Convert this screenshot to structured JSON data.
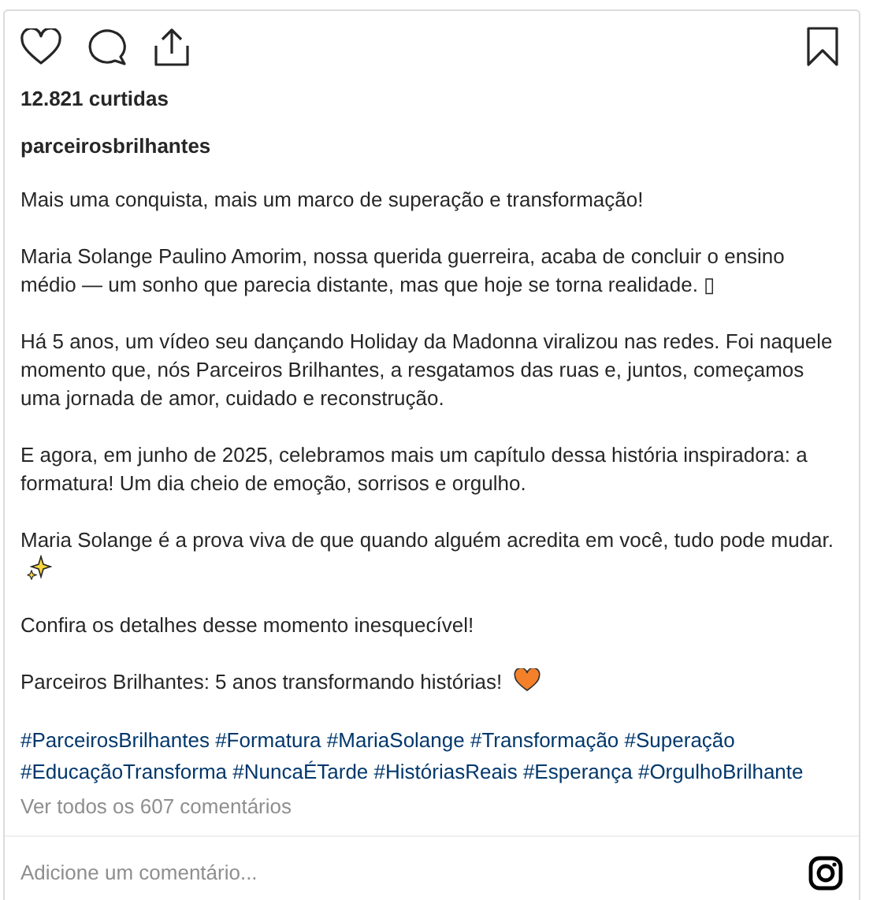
{
  "actions": {
    "liked": false,
    "saved": false
  },
  "likes": "12.821 curtidas",
  "username": "parceirosbrilhantes",
  "paragraphs": [
    {
      "text": "Mais uma conquista, mais um marco de superação e transformação!"
    },
    {
      "text": "Maria Solange Paulino Amorim, nossa querida guerreira, acaba de concluir o ensino médio — um sonho que parecia distante, mas que hoje se torna realidade. ▯"
    },
    {
      "text": "Há 5 anos, um vídeo seu dançando Holiday da Madonna viralizou nas redes. Foi naquele momento que, nós Parceiros Brilhantes, a resgatamos das ruas e, juntos, começamos uma jornada de amor, cuidado e reconstrução."
    },
    {
      "text": "E agora, em junho de 2025, celebramos mais um capítulo dessa história inspiradora: a formatura! Um dia cheio de emoção, sorrisos e orgulho."
    },
    {
      "text": "Maria Solange é a prova viva de que quando alguém acredita em você, tudo pode mudar.",
      "kind": "sparkles"
    },
    {
      "text": "Confira os detalhes desse momento inesquecível!"
    },
    {
      "text": "Parceiros Brilhantes: 5 anos transformando histórias!",
      "kind": "heart"
    }
  ],
  "hashtags": [
    "#ParceirosBrilhantes",
    "#Formatura",
    "#MariaSolange",
    "#Transformação",
    "#Superação",
    "#EducaçãoTransforma",
    "#NuncaÉTarde",
    "#HistóriasReais",
    "#Esperança",
    "#OrgulhoBrilhante"
  ],
  "view_comments": "Ver todos os 607 comentários",
  "comment": {
    "placeholder": "Adicione um comentário..."
  }
}
